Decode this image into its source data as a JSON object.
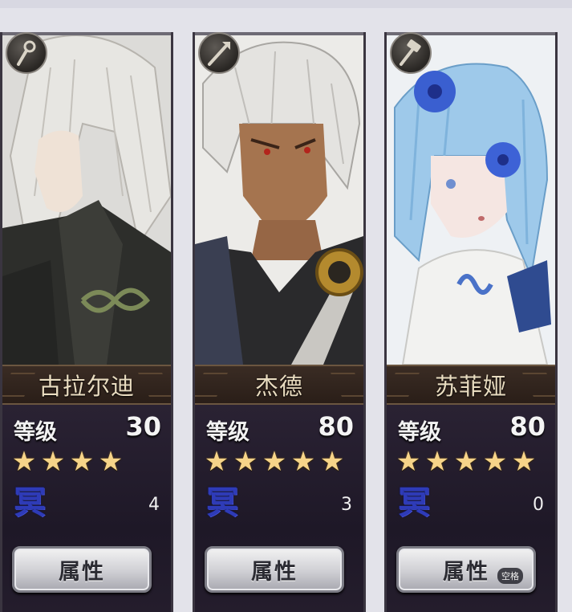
{
  "characters": [
    {
      "name": "古拉尔迪",
      "class_icon": "staff-icon",
      "level_label": "等级",
      "level": "30",
      "stars": 4,
      "mei_glyph": "冥",
      "mei_count": "4",
      "button_label": "属性"
    },
    {
      "name": "杰德",
      "class_icon": "spear-icon",
      "level_label": "等级",
      "level": "80",
      "stars": 5,
      "mei_glyph": "冥",
      "mei_count": "3",
      "button_label": "属性"
    },
    {
      "name": "苏菲娅",
      "class_icon": "hammer-icon",
      "level_label": "等级",
      "level": "80",
      "stars": 5,
      "mei_glyph": "冥",
      "mei_count": "0",
      "button_label": "属性"
    }
  ],
  "hint": {
    "space_label": "空格"
  },
  "colors": {
    "star": "#f6d489",
    "mei": "#2e3bb8",
    "name_text": "#e9dcc0"
  }
}
